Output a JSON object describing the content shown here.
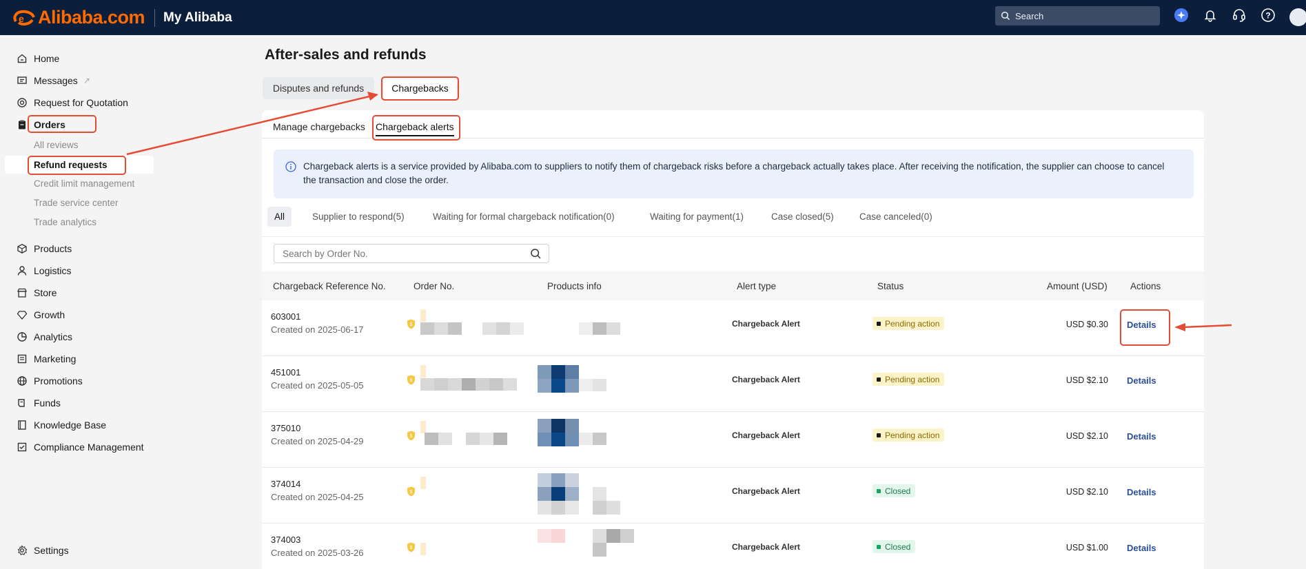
{
  "topbar": {
    "brand": "Alibaba.com",
    "section": "My Alibaba",
    "search_label": "Search"
  },
  "sidebar": {
    "items": [
      {
        "label": "Home",
        "icon": "home-icon"
      },
      {
        "label": "Messages",
        "icon": "message-icon",
        "external_mark": "↗"
      },
      {
        "label": "Request for Quotation",
        "icon": "target-icon"
      },
      {
        "label": "Orders",
        "icon": "clipboard-icon"
      },
      {
        "label": "Products",
        "icon": "box-icon"
      },
      {
        "label": "Logistics",
        "icon": "person-icon"
      },
      {
        "label": "Store",
        "icon": "store-icon"
      },
      {
        "label": "Growth",
        "icon": "diamond-icon"
      },
      {
        "label": "Analytics",
        "icon": "pie-icon"
      },
      {
        "label": "Marketing",
        "icon": "newspaper-icon"
      },
      {
        "label": "Promotions",
        "icon": "globe-icon"
      },
      {
        "label": "Funds",
        "icon": "wallet-icon"
      },
      {
        "label": "Knowledge Base",
        "icon": "book-icon"
      },
      {
        "label": "Compliance Management",
        "icon": "compliance-icon"
      }
    ],
    "order_sub_items": [
      "All reviews",
      "Refund requests",
      "Credit limit management",
      "Trade service center",
      "Trade analytics"
    ],
    "settings": "Settings"
  },
  "main": {
    "title": "After-sales and refunds",
    "tabs": [
      "Disputes and refunds",
      "Chargebacks"
    ],
    "subtabs": [
      "Manage chargebacks",
      "Chargeback alerts"
    ],
    "info": "Chargeback alerts is a service provided by Alibaba.com to suppliers to notify them of chargeback risks before a chargeback actually takes place. After receiving the notification, the supplier can choose to cancel the transaction and close the order.",
    "filters": [
      "All",
      "Supplier to respond(5)",
      "Waiting for formal chargeback notification(0)",
      "Waiting for payment(1)",
      "Case closed(5)",
      "Case canceled(0)"
    ],
    "search_placeholder": "Search by Order No.",
    "columns": [
      "Chargeback Reference No.",
      "Order No.",
      "Products info",
      "Alert type",
      "Status",
      "Amount (USD)",
      "Actions"
    ],
    "rows": [
      {
        "ref": "603001",
        "created": "Created on 2025-06-17",
        "alert": "Chargeback Alert",
        "status": "Pending action",
        "amount": "USD $0.30",
        "action": "Details"
      },
      {
        "ref": "451001",
        "created": "Created on 2025-05-05",
        "alert": "Chargeback Alert",
        "status": "Pending action",
        "amount": "USD $2.10",
        "action": "Details"
      },
      {
        "ref": "375010",
        "created": "Created on 2025-04-29",
        "alert": "Chargeback Alert",
        "status": "Pending action",
        "amount": "USD $2.10",
        "action": "Details"
      },
      {
        "ref": "374014",
        "created": "Created on 2025-04-25",
        "alert": "Chargeback Alert",
        "status": "Closed",
        "amount": "USD $2.10",
        "action": "Details"
      },
      {
        "ref": "374003",
        "created": "Created on 2025-03-26",
        "alert": "Chargeback Alert",
        "status": "Closed",
        "amount": "USD $1.00",
        "action": "Details"
      }
    ]
  },
  "colors": {
    "topbar": "#0b1f3c",
    "brand_orange": "#ff6a00",
    "annotation_red": "#e54c35",
    "link_blue": "#2b4e9b",
    "pending_bg": "#fdf3c8",
    "pending_dot": "#1a1a1a",
    "closed_bg": "#e3f6ec",
    "closed_dot": "#19a463"
  }
}
